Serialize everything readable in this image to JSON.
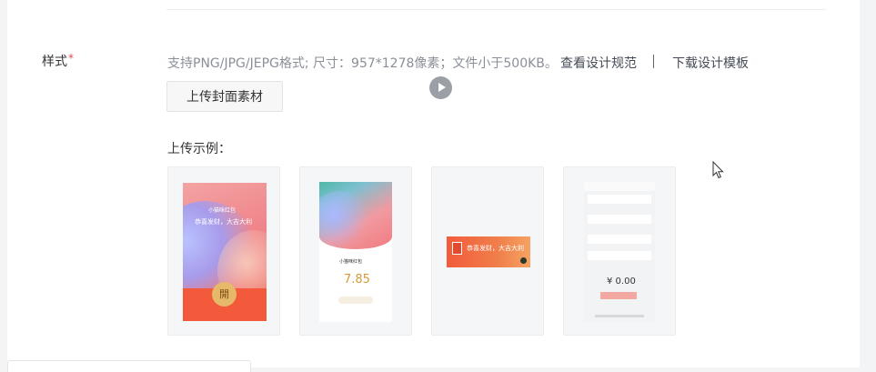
{
  "form": {
    "label": "样式",
    "required_mark": "*",
    "hint": "支持PNG/JPG/JEPG格式; 尺寸：957*1278像素；文件小于500KB。",
    "link_spec": "查看设计规范",
    "link_template": "下载设计模板",
    "upload_button": "上传封面素材",
    "examples_label": "上传示例："
  },
  "examples": [
    {
      "brand": "小猫咪红包",
      "greeting": "恭喜发财，大吉大利",
      "open": "開"
    },
    {
      "brand": "小猫咪红包",
      "amount": "7.85"
    },
    {
      "greeting": "恭喜发财，大吉大利"
    },
    {
      "amount": "¥ 0.00"
    }
  ],
  "colors": {
    "accent_red": "#f25a3b",
    "gold": "#e6b86a",
    "link": "#454b57",
    "hint": "#8a8f99"
  },
  "icons": [
    "play-icon",
    "mouse-cursor-icon",
    "envelope-icon"
  ]
}
